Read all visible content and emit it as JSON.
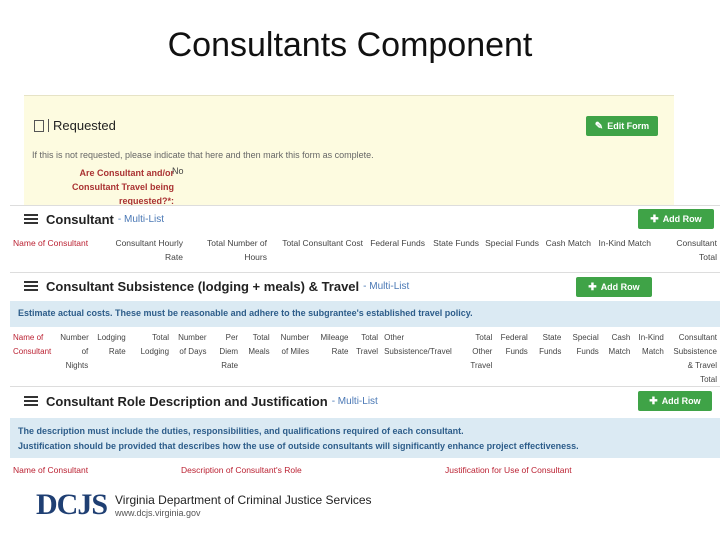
{
  "slide_title": "Consultants Component",
  "requested": {
    "header": "Requested",
    "edit_button": "Edit Form",
    "hint": "If this is not requested, please indicate that here and then mark this form as complete.",
    "question": "Are Consultant and/or Consultant Travel being requested?*:",
    "answer": "No"
  },
  "consultant": {
    "title": "Consultant",
    "subtitle": "- Multi-List",
    "add_button": "Add Row",
    "columns": [
      "Name of Consultant",
      "Consultant Hourly Rate",
      "Total Number of Hours",
      "Total Consultant Cost",
      "Federal Funds",
      "State Funds",
      "Special Funds",
      "Cash Match",
      "In-Kind Match",
      "Consultant Total"
    ]
  },
  "subsistence": {
    "title": "Consultant Subsistence (lodging + meals) & Travel",
    "subtitle": "- Multi-List",
    "add_button": "Add Row",
    "info": "Estimate actual costs. These must be reasonable and adhere to the subgrantee's established travel policy.",
    "columns": [
      "Name of Consultant",
      "Number of Nights",
      "Lodging Rate",
      "Total Lodging",
      "Number of Days",
      "Per Diem Rate",
      "Total Meals",
      "Number of Miles",
      "Mileage Rate",
      "Total Travel",
      "Other Subsistence/Travel",
      "Total Other Travel",
      "Federal Funds",
      "State Funds",
      "Special Funds",
      "Cash Match",
      "In-Kind Match",
      "Consultant Subsistence & Travel Total"
    ]
  },
  "role": {
    "title": "Consultant Role Description and Justification",
    "subtitle": "- Multi-List",
    "add_button": "Add Row",
    "info_line1": "The description must include the duties, responsibilities, and qualifications required of each consultant.",
    "info_line2": "Justification should be provided that describes how the use of outside consultants will significantly enhance project effectiveness.",
    "columns": [
      "Name of Consultant",
      "Description of Consultant's Role",
      "Justification for Use of Consultant"
    ]
  },
  "footer": {
    "logo": "DCJS",
    "org_name": "Virginia Department of Criminal Justice Services",
    "url": "www.dcjs.virginia.gov"
  },
  "colors": {
    "accent_green": "#3fa347",
    "info_blue": "#dbeaf3",
    "label_red": "#b23333"
  },
  "icons": [
    "document-icon",
    "list-icon",
    "plus-icon",
    "edit-icon"
  ]
}
